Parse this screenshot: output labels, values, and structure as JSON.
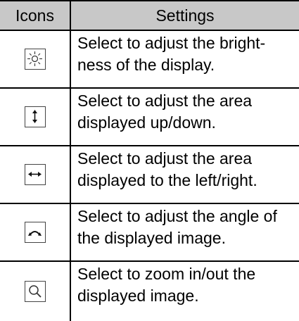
{
  "table": {
    "headers": {
      "icons": "Icons",
      "settings": "Settings"
    },
    "rows": [
      {
        "icon": "brightness-icon",
        "text": "Select to adjust the bright-\nness of the display."
      },
      {
        "icon": "vertical-adjust-icon",
        "text": "Select to adjust the area\ndisplayed up/down."
      },
      {
        "icon": "horizontal-adjust-icon",
        "text": "Select to adjust the area\ndisplayed to the left/right."
      },
      {
        "icon": "angle-adjust-icon",
        "text": "Select to adjust the angle of\nthe displayed image."
      },
      {
        "icon": "zoom-icon",
        "text": "Select to zoom in/out the\ndisplayed image."
      }
    ]
  }
}
